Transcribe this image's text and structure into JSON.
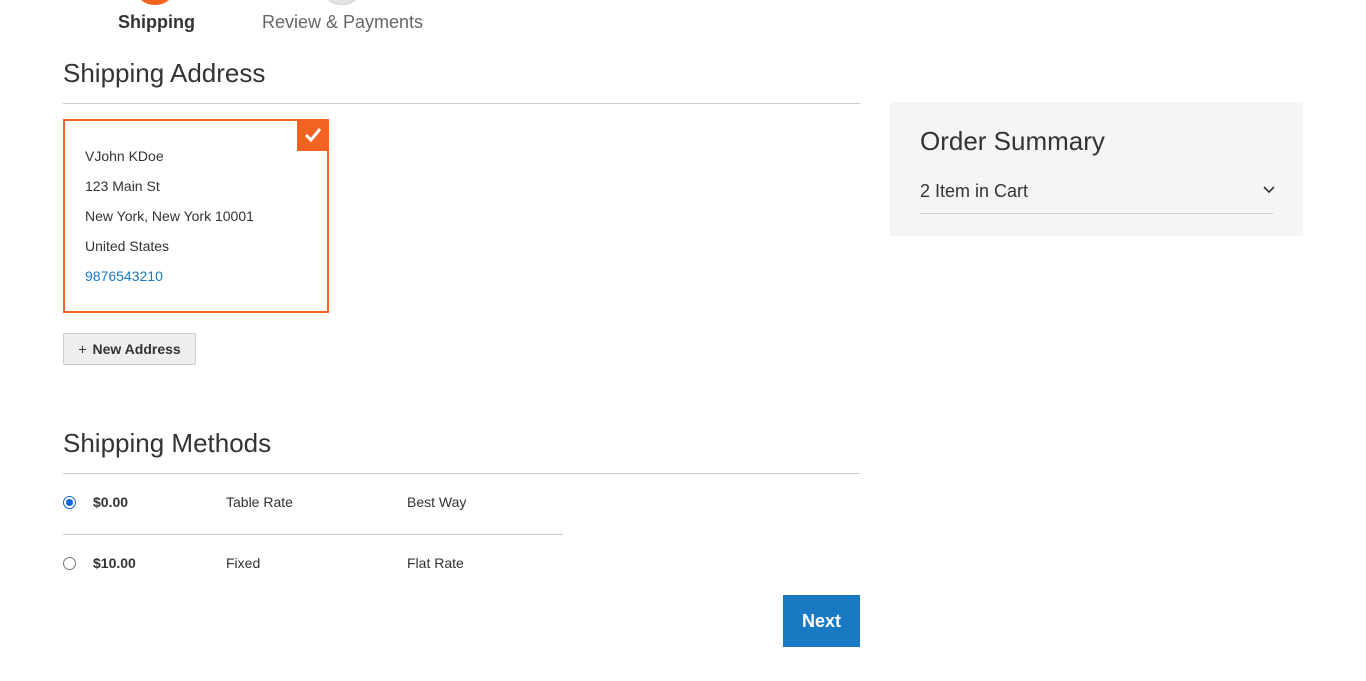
{
  "progress": {
    "steps": [
      {
        "label": "Shipping",
        "state": "active"
      },
      {
        "label": "Review & Payments",
        "state": "inactive"
      }
    ]
  },
  "shipping_address": {
    "title": "Shipping Address",
    "selected_address": {
      "name": "VJohn KDoe",
      "street": "123 Main St",
      "city_line": "New York, New York 10001",
      "country": "United States",
      "phone": "9876543210"
    },
    "new_address_label": "New Address",
    "new_address_icon": "+"
  },
  "shipping_methods": {
    "title": "Shipping Methods",
    "methods": [
      {
        "price": "$0.00",
        "method": "Table Rate",
        "carrier": "Best Way",
        "selected": true
      },
      {
        "price": "$10.00",
        "method": "Fixed",
        "carrier": "Flat Rate",
        "selected": false
      }
    ]
  },
  "next_label": "Next",
  "order_summary": {
    "title": "Order Summary",
    "items_label": "2 Item in Cart"
  },
  "colors": {
    "accent": "#f26322",
    "primary_button": "#1979c3",
    "link": "#1979c3",
    "summary_bg": "#f5f5f5"
  },
  "icons": {
    "card_check": "checkmark-icon",
    "summary_toggle": "chevron-down-icon"
  }
}
